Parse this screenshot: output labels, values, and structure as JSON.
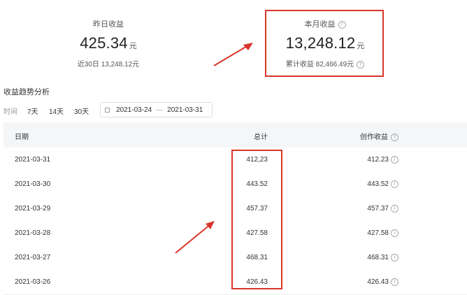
{
  "yesterday": {
    "label": "昨日收益",
    "value": "425.34",
    "unit": "元",
    "sub": "近30日 13,248.12元"
  },
  "month": {
    "label": "本月收益",
    "value": "13,248.12",
    "unit": "元",
    "sub": "累计收益 82,466.49元"
  },
  "trend": {
    "title": "收益趋势分析",
    "time_label": "时间",
    "options": [
      "7天",
      "14天",
      "30天"
    ],
    "date_start": "2021-03-24",
    "date_sep": "—",
    "date_end": "2021-03-31"
  },
  "table": {
    "headers": {
      "date": "日期",
      "total": "总计",
      "creation": "创作收益"
    },
    "rows": [
      {
        "date": "2021-03-31",
        "total": "412,23",
        "creation": "412.23"
      },
      {
        "date": "2021-03-30",
        "total": "443.52",
        "creation": "443.52"
      },
      {
        "date": "2021-03-29",
        "total": "457.37",
        "creation": "457.37"
      },
      {
        "date": "2021-03-28",
        "total": "427.58",
        "creation": "427.58"
      },
      {
        "date": "2021-03-27",
        "total": "468.31",
        "creation": "468.31"
      },
      {
        "date": "2021-03-26",
        "total": "426.43",
        "creation": "426.43"
      }
    ]
  },
  "colors": {
    "highlight": "#d9362b",
    "header_bg": "#f5f6f8"
  }
}
